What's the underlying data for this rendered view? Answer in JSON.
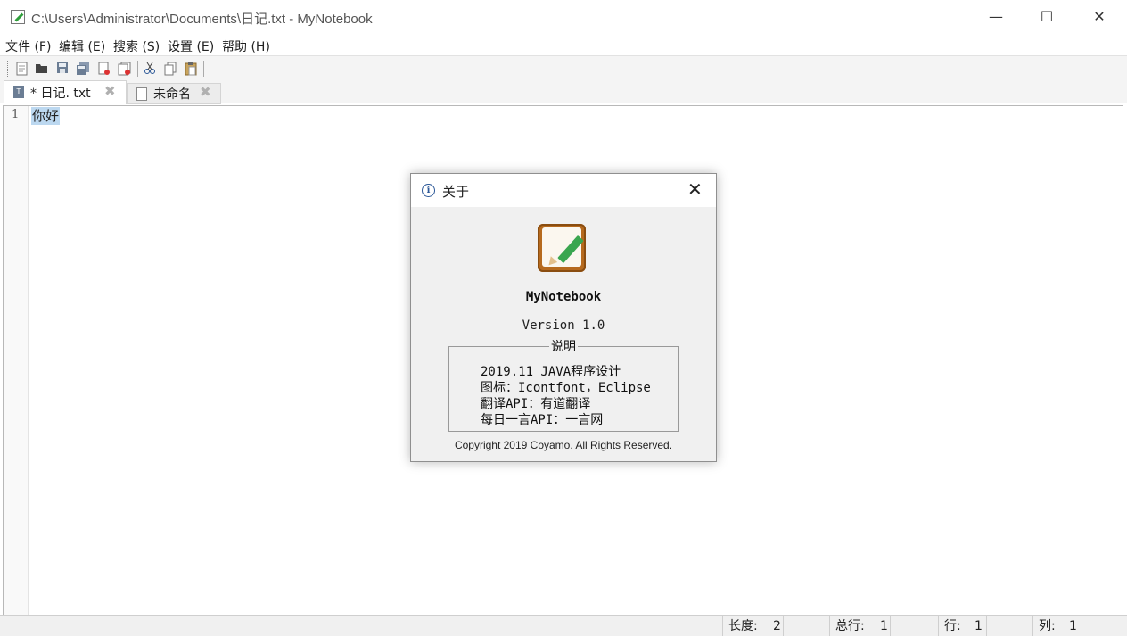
{
  "window": {
    "title": "C:\\Users\\Administrator\\Documents\\日记.txt - MyNotebook",
    "minimize_glyph": "—",
    "maximize_glyph": "☐",
    "close_glyph": "✕"
  },
  "menu": [
    "文件 (F)",
    "编辑 (E)",
    "搜索 (S)",
    "设置 (E)",
    "帮助 (H)"
  ],
  "toolbar": {
    "buttons": [
      "new-file-icon",
      "open-file-icon",
      "save-icon",
      "save-all-icon",
      "close-file-icon",
      "close-all-icon",
      "cut-icon",
      "copy-icon",
      "paste-icon"
    ]
  },
  "tabs": [
    {
      "label": "* 日记. txt",
      "active": true,
      "icon": "T"
    },
    {
      "label": "未命名",
      "active": false
    }
  ],
  "tab_close_glyph": "✖",
  "editor": {
    "line_number": "1",
    "line_text": "你好",
    "selection_color": "#bcd8f0"
  },
  "status": {
    "length_label": "长度:",
    "length_value": "2",
    "total_lines_label": "总行:",
    "total_lines_value": "1",
    "row_label": "行:",
    "row_value": "1",
    "col_label": "列:",
    "col_value": "1"
  },
  "about_dialog": {
    "title": "关于",
    "info_glyph": "i",
    "close_glyph": "✕",
    "app_name": "MyNotebook",
    "version": "Version 1.0",
    "section_title": "说明",
    "lines": [
      "2019.11 JAVA程序设计",
      "图标：Icontfont，Eclipse",
      "翻译API：有道翻译",
      "每日一言API：一言网"
    ],
    "copyright": "Copyright 2019  Coyamo. All Rights Reserved."
  },
  "colors": {
    "accent_pencil": "#3aa64f",
    "logo_frame": "#b66a1e"
  }
}
